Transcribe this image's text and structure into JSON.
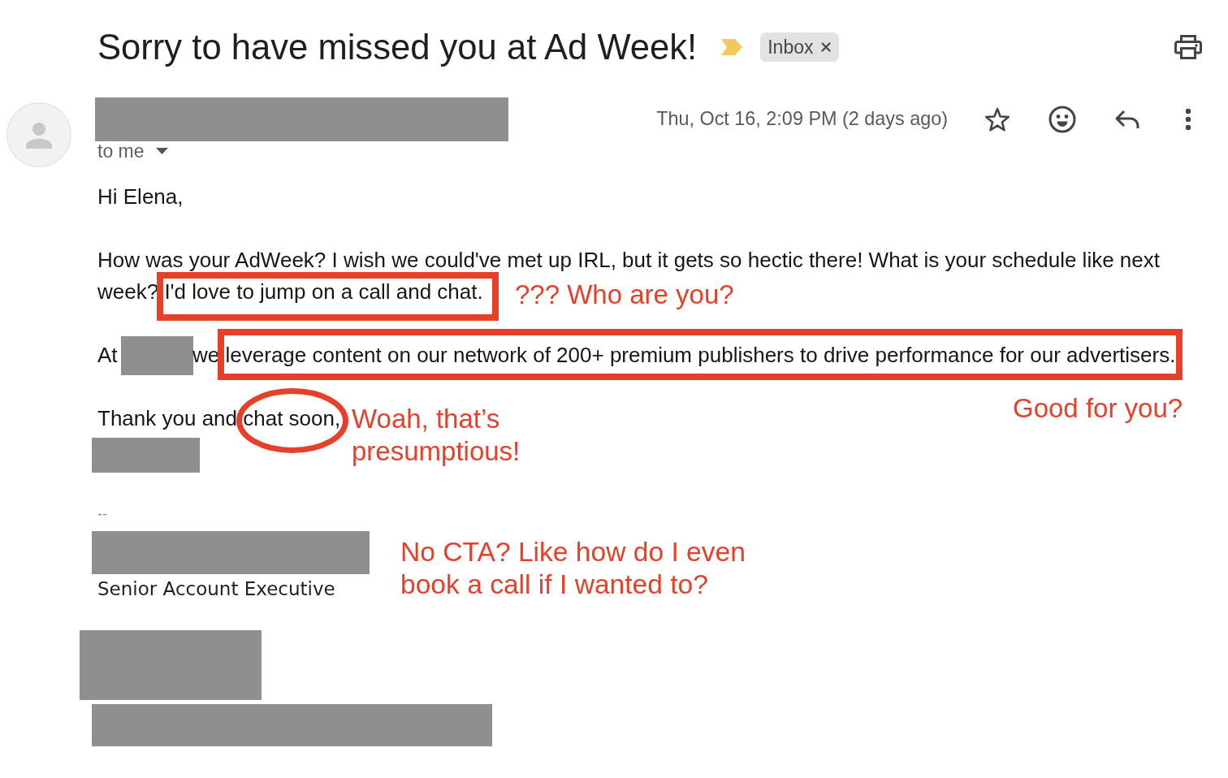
{
  "subject": "Sorry to have missed you at Ad Week!",
  "important": true,
  "labels": [
    "Inbox"
  ],
  "sender": {
    "kind": "redacted"
  },
  "recipient": "to me",
  "date": "Thu, Oct 16, 2:09 PM (2 days ago)",
  "starred": false,
  "body": [
    {
      "segments": [
        {
          "kind": "plain",
          "text": "Hi Elena,"
        }
      ]
    },
    {
      "segments": [
        {
          "kind": "plain",
          "text": "How was your AdWeek? I wish we could've met up IRL, but it gets so hectic there! What is your schedule like next"
        },
        {
          "kind": "plain",
          "text": "week?"
        },
        {
          "kind": "boxed",
          "text": "I'd love to jump on a call and chat."
        }
      ]
    },
    {
      "segments": [
        {
          "kind": "plain",
          "text": "At"
        },
        {
          "kind": "redacted"
        },
        {
          "kind": "plain",
          "text": "we"
        },
        {
          "kind": "boxed",
          "text": "leverage content on our network of 200+ premium publishers to drive performance for our advertisers."
        }
      ]
    },
    {
      "segments": [
        {
          "kind": "plain",
          "text": "Thank you and"
        },
        {
          "kind": "circled",
          "text": "chat soon,"
        }
      ]
    }
  ],
  "signature": [
    {
      "kind": "redacted"
    },
    {
      "kind": "separator",
      "text": "--"
    },
    {
      "kind": "redacted"
    },
    {
      "kind": "text",
      "text": "Senior Account Executive"
    },
    {
      "kind": "redacted"
    },
    {
      "kind": "redacted"
    }
  ],
  "annotations": [
    "??? Who are you?",
    "Good for you?",
    "Woah, that’s presumptious!",
    "No CTA? Like how do I even book a call if I wanted to?"
  ]
}
